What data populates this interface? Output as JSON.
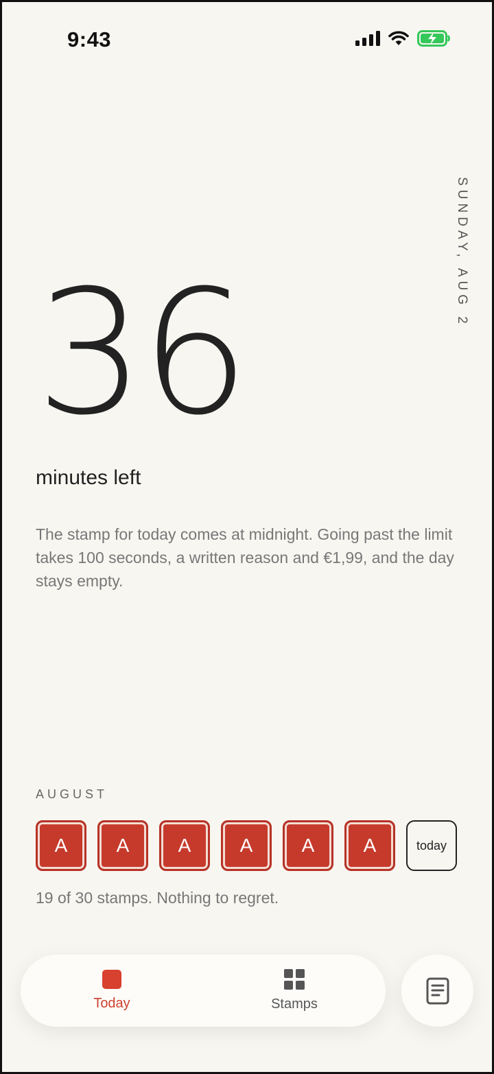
{
  "status_bar": {
    "time": "9:43"
  },
  "date": "SUNDAY, AUG 2",
  "counter": {
    "value": "36",
    "label": "minutes left"
  },
  "description": "The stamp for today comes at midnight. Going past the limit takes 100 seconds, a written reason and €1,99, and the day stays empty.",
  "month": {
    "label": "AUGUST",
    "stamps": [
      {
        "letter": "A"
      },
      {
        "letter": "A"
      },
      {
        "letter": "A"
      },
      {
        "letter": "A"
      },
      {
        "letter": "A"
      },
      {
        "letter": "A"
      }
    ],
    "today_label": "today",
    "summary": "19 of 30 stamps. Nothing to regret."
  },
  "tabbar": {
    "tabs": [
      {
        "label": "Today",
        "icon": "square-icon",
        "active": true
      },
      {
        "label": "Stamps",
        "icon": "grid-icon",
        "active": false
      }
    ],
    "journal_icon": "journal-icon"
  },
  "colors": {
    "background": "#f8f6f1",
    "accent": "#d0402f",
    "stamp": "#c63a2c",
    "battery": "#34c759"
  }
}
